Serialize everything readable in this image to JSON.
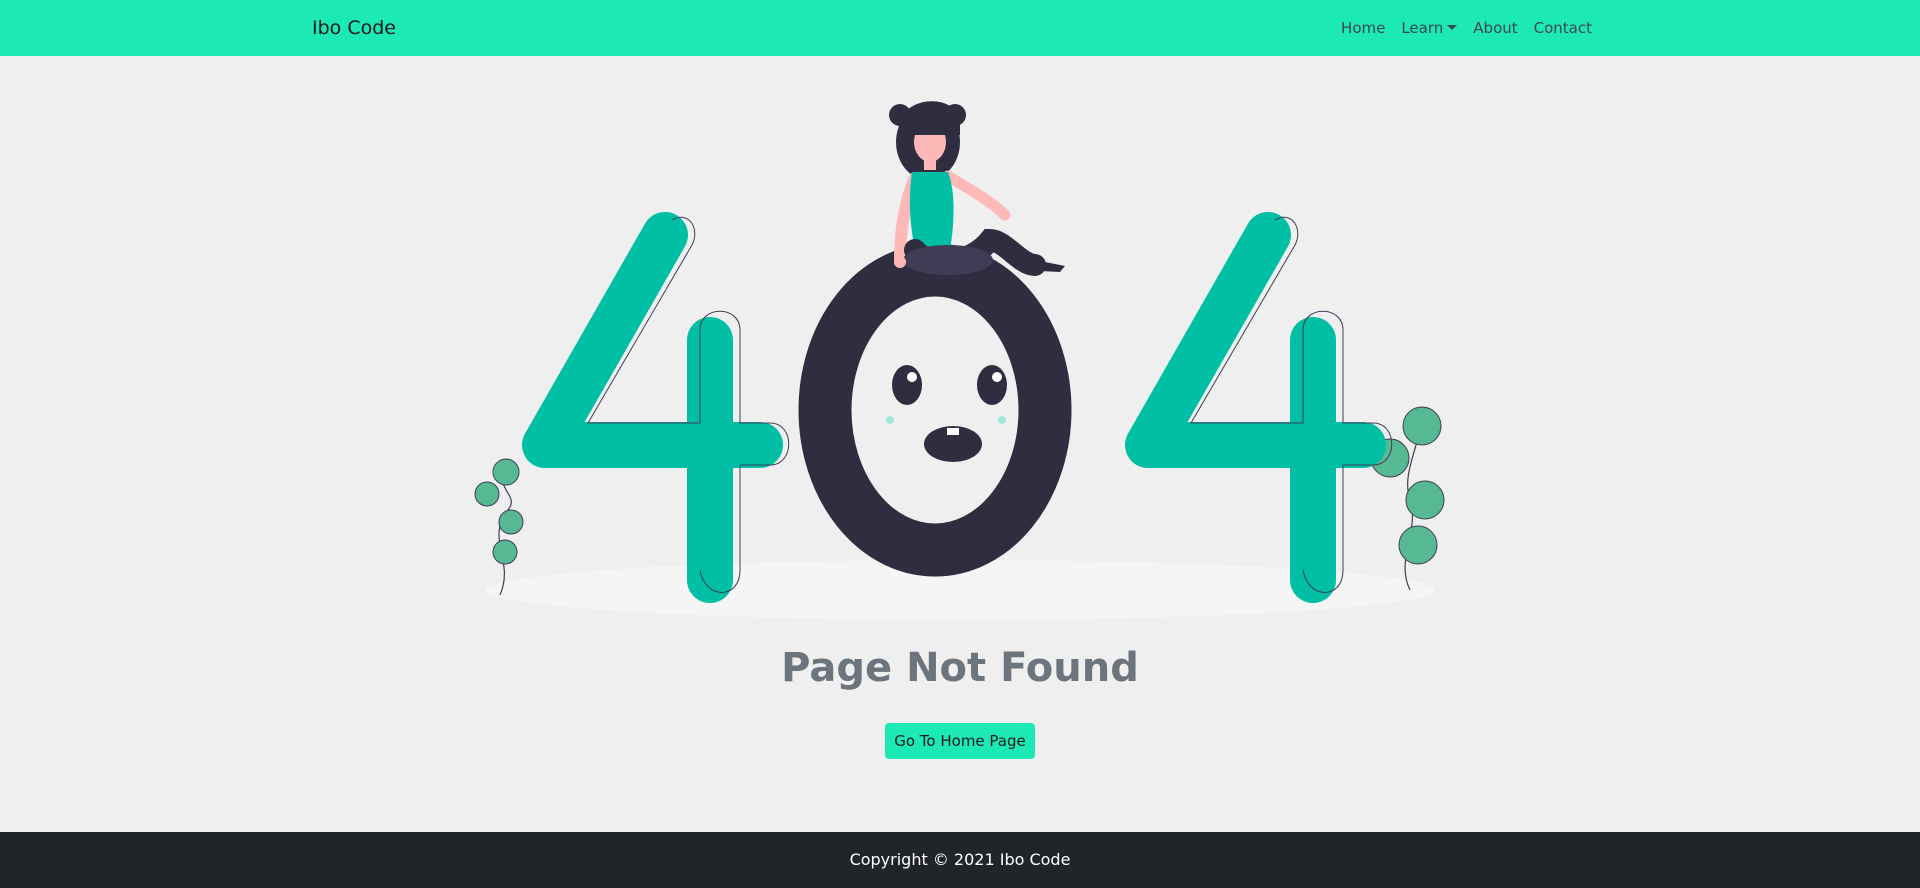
{
  "navbar": {
    "brand": "Ibo Code",
    "links": [
      {
        "label": "Home"
      },
      {
        "label": "Learn"
      },
      {
        "label": "About"
      },
      {
        "label": "Contact"
      }
    ]
  },
  "main": {
    "title": "Page Not Found",
    "button_label": "Go To Home Page"
  },
  "footer": {
    "copyright": "Copyright © 2021 Ibo Code"
  },
  "colors": {
    "accent": "#1de9b6",
    "digit": "#00bfa5",
    "zero": "#2f2e41",
    "footer": "#212529",
    "title": "#6c757d"
  }
}
